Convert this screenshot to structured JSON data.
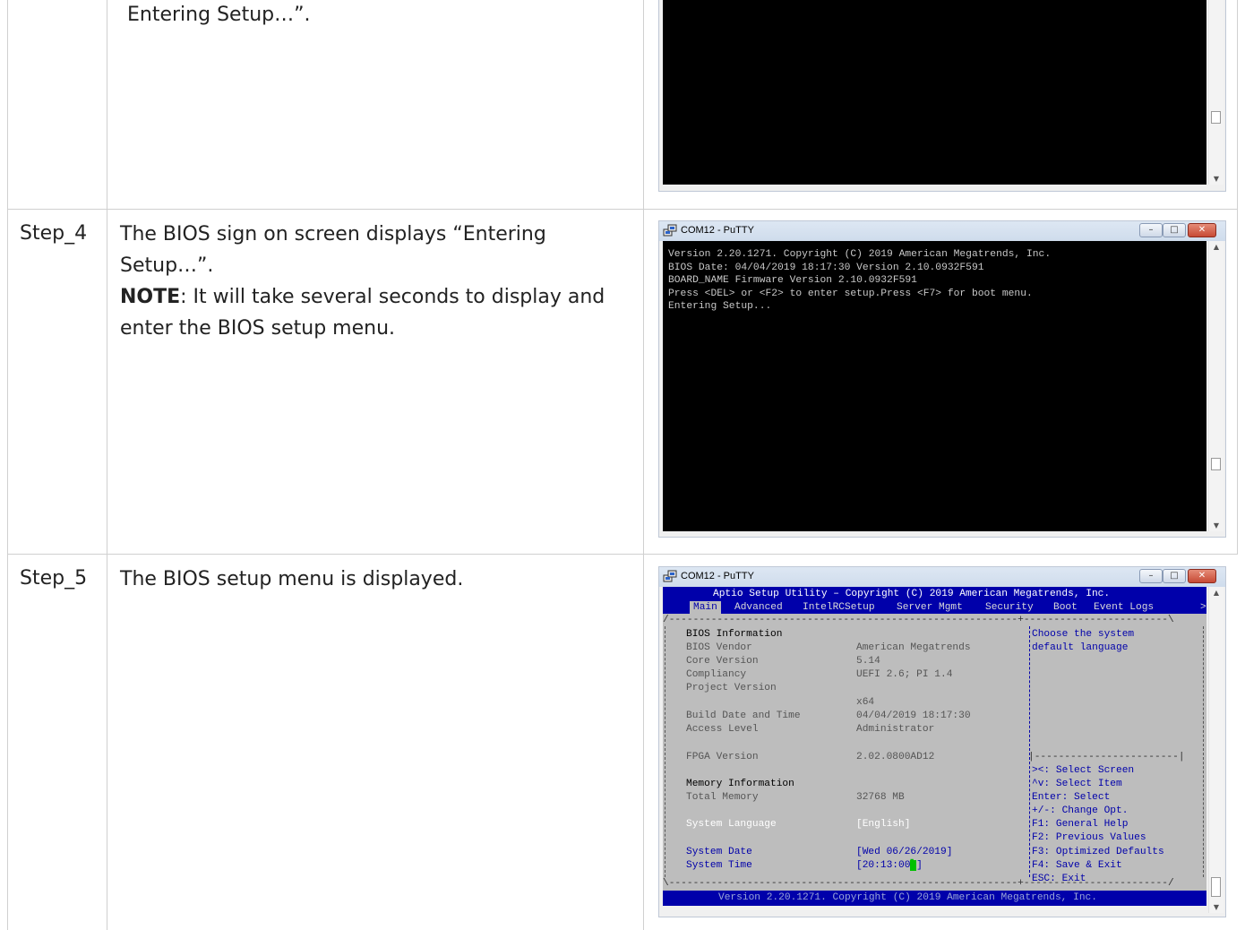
{
  "rows": [
    {
      "step": "",
      "text": "Entering Setup…”.",
      "window": {
        "title": "",
        "lines": []
      }
    },
    {
      "step": "Step_4",
      "text": "The BIOS sign on screen displays “Entering Setup…”.",
      "note_label": "NOTE",
      "note_text": ": It will take several seconds to display and enter the BIOS setup menu.",
      "window": {
        "title": "COM12 - PuTTY",
        "lines": [
          "Version 2.20.1271. Copyright (C) 2019 American Megatrends, Inc.",
          "BIOS Date: 04/04/2019 18:17:30 Version 2.10.0932F591",
          "BOARD_NAME Firmware Version 2.10.0932F591",
          "Press <DEL> or <F2> to enter setup.Press <F7> for boot menu.",
          "Entering Setup..."
        ]
      }
    },
    {
      "step": "Step_5",
      "text": "The BIOS setup menu is displayed.",
      "window": {
        "title": "COM12 - PuTTY",
        "bios": {
          "header": "Aptio Setup Utility – Copyright (C) 2019 American Megatrends, Inc.",
          "menu": [
            "Main",
            "Advanced",
            "IntelRCSetup",
            "Server Mgmt",
            "Security",
            "Boot",
            "Event Logs"
          ],
          "menu_more": ">",
          "bios_info_label": "BIOS Information",
          "fields": [
            {
              "label": "BIOS Vendor",
              "value": "American Megatrends"
            },
            {
              "label": "Core Version",
              "value": "5.14"
            },
            {
              "label": "Compliancy",
              "value": "UEFI 2.6; PI 1.4"
            },
            {
              "label": "Project Version",
              "value": ""
            },
            {
              "label": "",
              "value": "x64"
            },
            {
              "label": "Build Date and Time",
              "value": "04/04/2019 18:17:30"
            },
            {
              "label": "Access Level",
              "value": "Administrator"
            },
            {
              "label": "FPGA Version",
              "value": "2.02.0800AD12"
            }
          ],
          "memory_label": "Memory Information",
          "total_memory_label": "Total Memory",
          "total_memory_value": "32768 MB",
          "system_language_label": "System Language",
          "system_language_value": "[English]",
          "system_date_label": "System Date",
          "system_date_value": "[Wed 06/26/2019]",
          "system_time_label": "System Time",
          "system_time_value": "[20:13:00",
          "system_time_end": "]",
          "help_text": [
            "Choose the system",
            "default language"
          ],
          "keys": [
            "><: Select Screen",
            "^v: Select Item",
            "Enter: Select",
            "+/-: Change Opt.",
            "F1: General Help",
            "F2: Previous Values",
            "F3: Optimized Defaults",
            "F4: Save & Exit",
            "ESC: Exit"
          ],
          "footer": "Version 2.20.1271. Copyright (C) 2019 American Megatrends, Inc."
        }
      }
    }
  ],
  "icons": {
    "putty": "putty-icon",
    "minimize": "minimize-icon",
    "maximize": "maximize-icon",
    "close": "close-icon"
  }
}
